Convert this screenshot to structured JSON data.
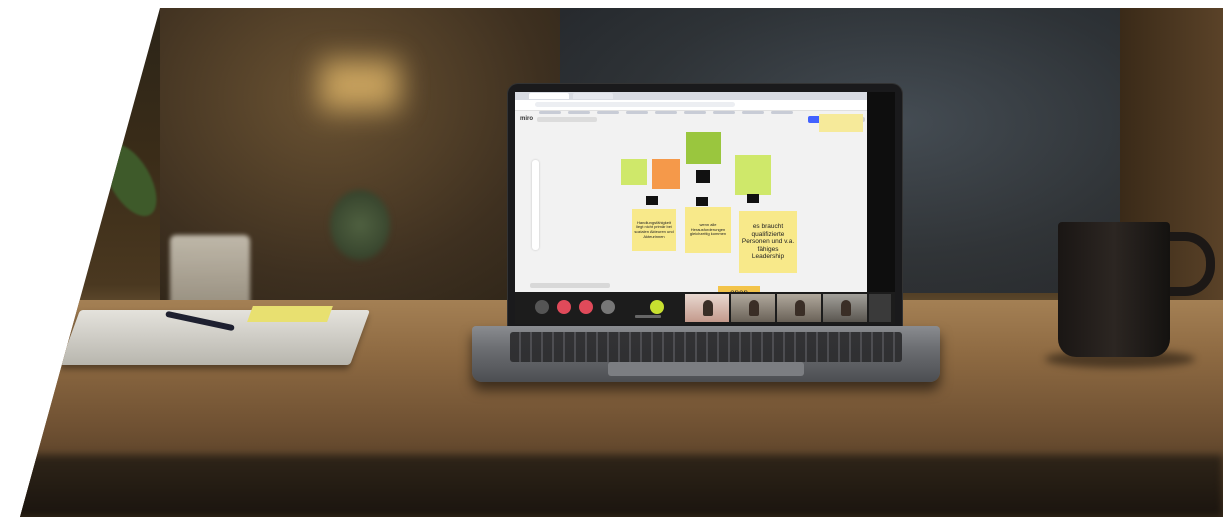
{
  "scene": {
    "description_objects": [
      "laptop",
      "coffee-mug",
      "papers",
      "pen",
      "plant",
      "lamp"
    ]
  },
  "board": {
    "logo": "miro",
    "stickies": [
      {
        "id": "s1",
        "color": "green",
        "text": ""
      },
      {
        "id": "s2",
        "color": "orange",
        "text": ""
      },
      {
        "id": "s3",
        "color": "dark-green",
        "text": ""
      },
      {
        "id": "s4",
        "color": "green",
        "text": ""
      },
      {
        "id": "s5",
        "color": "yellow",
        "text": "Handlungsfähigkeit liegt nicht primär bei sozialen Akteuren und Akteurinnen"
      },
      {
        "id": "s6",
        "color": "yellow",
        "text": "wenn alle Herausforderungen gleichzeitig kommen"
      },
      {
        "id": "s7",
        "color": "yellow",
        "text": "es braucht qualifizierte Personen und v.a. fähiges Leadership"
      }
    ],
    "open_label": "open"
  },
  "colors": {
    "sticky_yellow": "#f8e98a",
    "sticky_green": "#cfe86a",
    "sticky_orange": "#f5994a",
    "zoom_bar": "#1c1c1c",
    "miro_blue": "#4262ff"
  }
}
